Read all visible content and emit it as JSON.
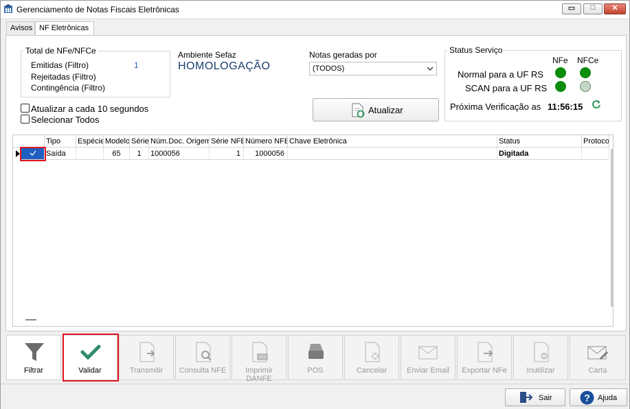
{
  "window": {
    "title": "Gerenciamento de Notas Fiscais Eletrônicas",
    "minimize": "▭",
    "maximize": "□",
    "close": "✕"
  },
  "tabs": [
    {
      "label": "Avisos"
    },
    {
      "label": "NF Eletrônicas"
    }
  ],
  "totals": {
    "group_label": "Total de NFe/NFCe",
    "emitidas_label": "Emitidas (Filtro)",
    "emitidas_value": "1",
    "rejeitadas_label": "Rejeitadas (Filtro)",
    "contingencia_label": "Contingência (Filtro)"
  },
  "ambiente": {
    "label": "Ambiente Sefaz",
    "value": "HOMOLOGAÇÃO"
  },
  "notas_geradas": {
    "label": "Notas geradas por",
    "selected": "(TODOS)"
  },
  "options": {
    "atualizar_label": "Atualizar a cada 10 segundos",
    "selecionar_label": "Selecionar Todos"
  },
  "atualizar_button": "Atualizar",
  "status": {
    "group_label": "Status Serviço",
    "col_nfe": "NFe",
    "col_nfce": "NFCe",
    "normal_label": "Normal para a UF RS",
    "scan_label": "SCAN para a UF RS",
    "proxima_label": "Próxima Verificação as",
    "proxima_time": "11:56:15",
    "colors": {
      "online": "#0b8c0b",
      "offline": "#c7d7c7"
    }
  },
  "grid": {
    "columns": [
      "Tipo",
      "Espécie",
      "Modelo",
      "Série",
      "Núm.Doc. Origem",
      "Série NFE",
      "Número NFE",
      "Chave Eletrônica",
      "Status",
      "Protocolo"
    ],
    "rows": [
      {
        "tipo": "Saída",
        "especie": "",
        "modelo": "65",
        "serie": "1",
        "num_doc": "1000056",
        "serie_nfe": "1",
        "numero_nfe": "1000056",
        "chave": "",
        "status": "Digitada",
        "protocolo": ""
      }
    ]
  },
  "toolbar": [
    {
      "label": "Filtrar",
      "icon": "funnel-icon",
      "enabled": true
    },
    {
      "label": "Validar",
      "icon": "checkmark-icon",
      "enabled": true
    },
    {
      "label": "Transmitir",
      "icon": "document-arrow-icon",
      "enabled": false
    },
    {
      "label": "Consulta NFE",
      "icon": "document-search-icon",
      "enabled": false
    },
    {
      "label": "Imprimir DANFE",
      "icon": "document-printer-icon",
      "enabled": false
    },
    {
      "label": "POS",
      "icon": "pos-printer-icon",
      "enabled": false
    },
    {
      "label": "Cancelar",
      "icon": "document-cancel-icon",
      "enabled": false
    },
    {
      "label": "Enviar Email",
      "icon": "envelope-arrow-icon",
      "enabled": false
    },
    {
      "label": "Exportar NFe",
      "icon": "document-export-icon",
      "enabled": false
    },
    {
      "label": "Inutilizar",
      "icon": "document-minus-icon",
      "enabled": false
    },
    {
      "label": "Carta",
      "icon": "envelope-pen-icon",
      "enabled": false
    }
  ],
  "footer": {
    "sair": "Sair",
    "ajuda": "Ajuda"
  },
  "colors": {
    "accent": "#1a5fb4",
    "highlight": "#e0141e",
    "validar_check": "#2e8b6a"
  }
}
